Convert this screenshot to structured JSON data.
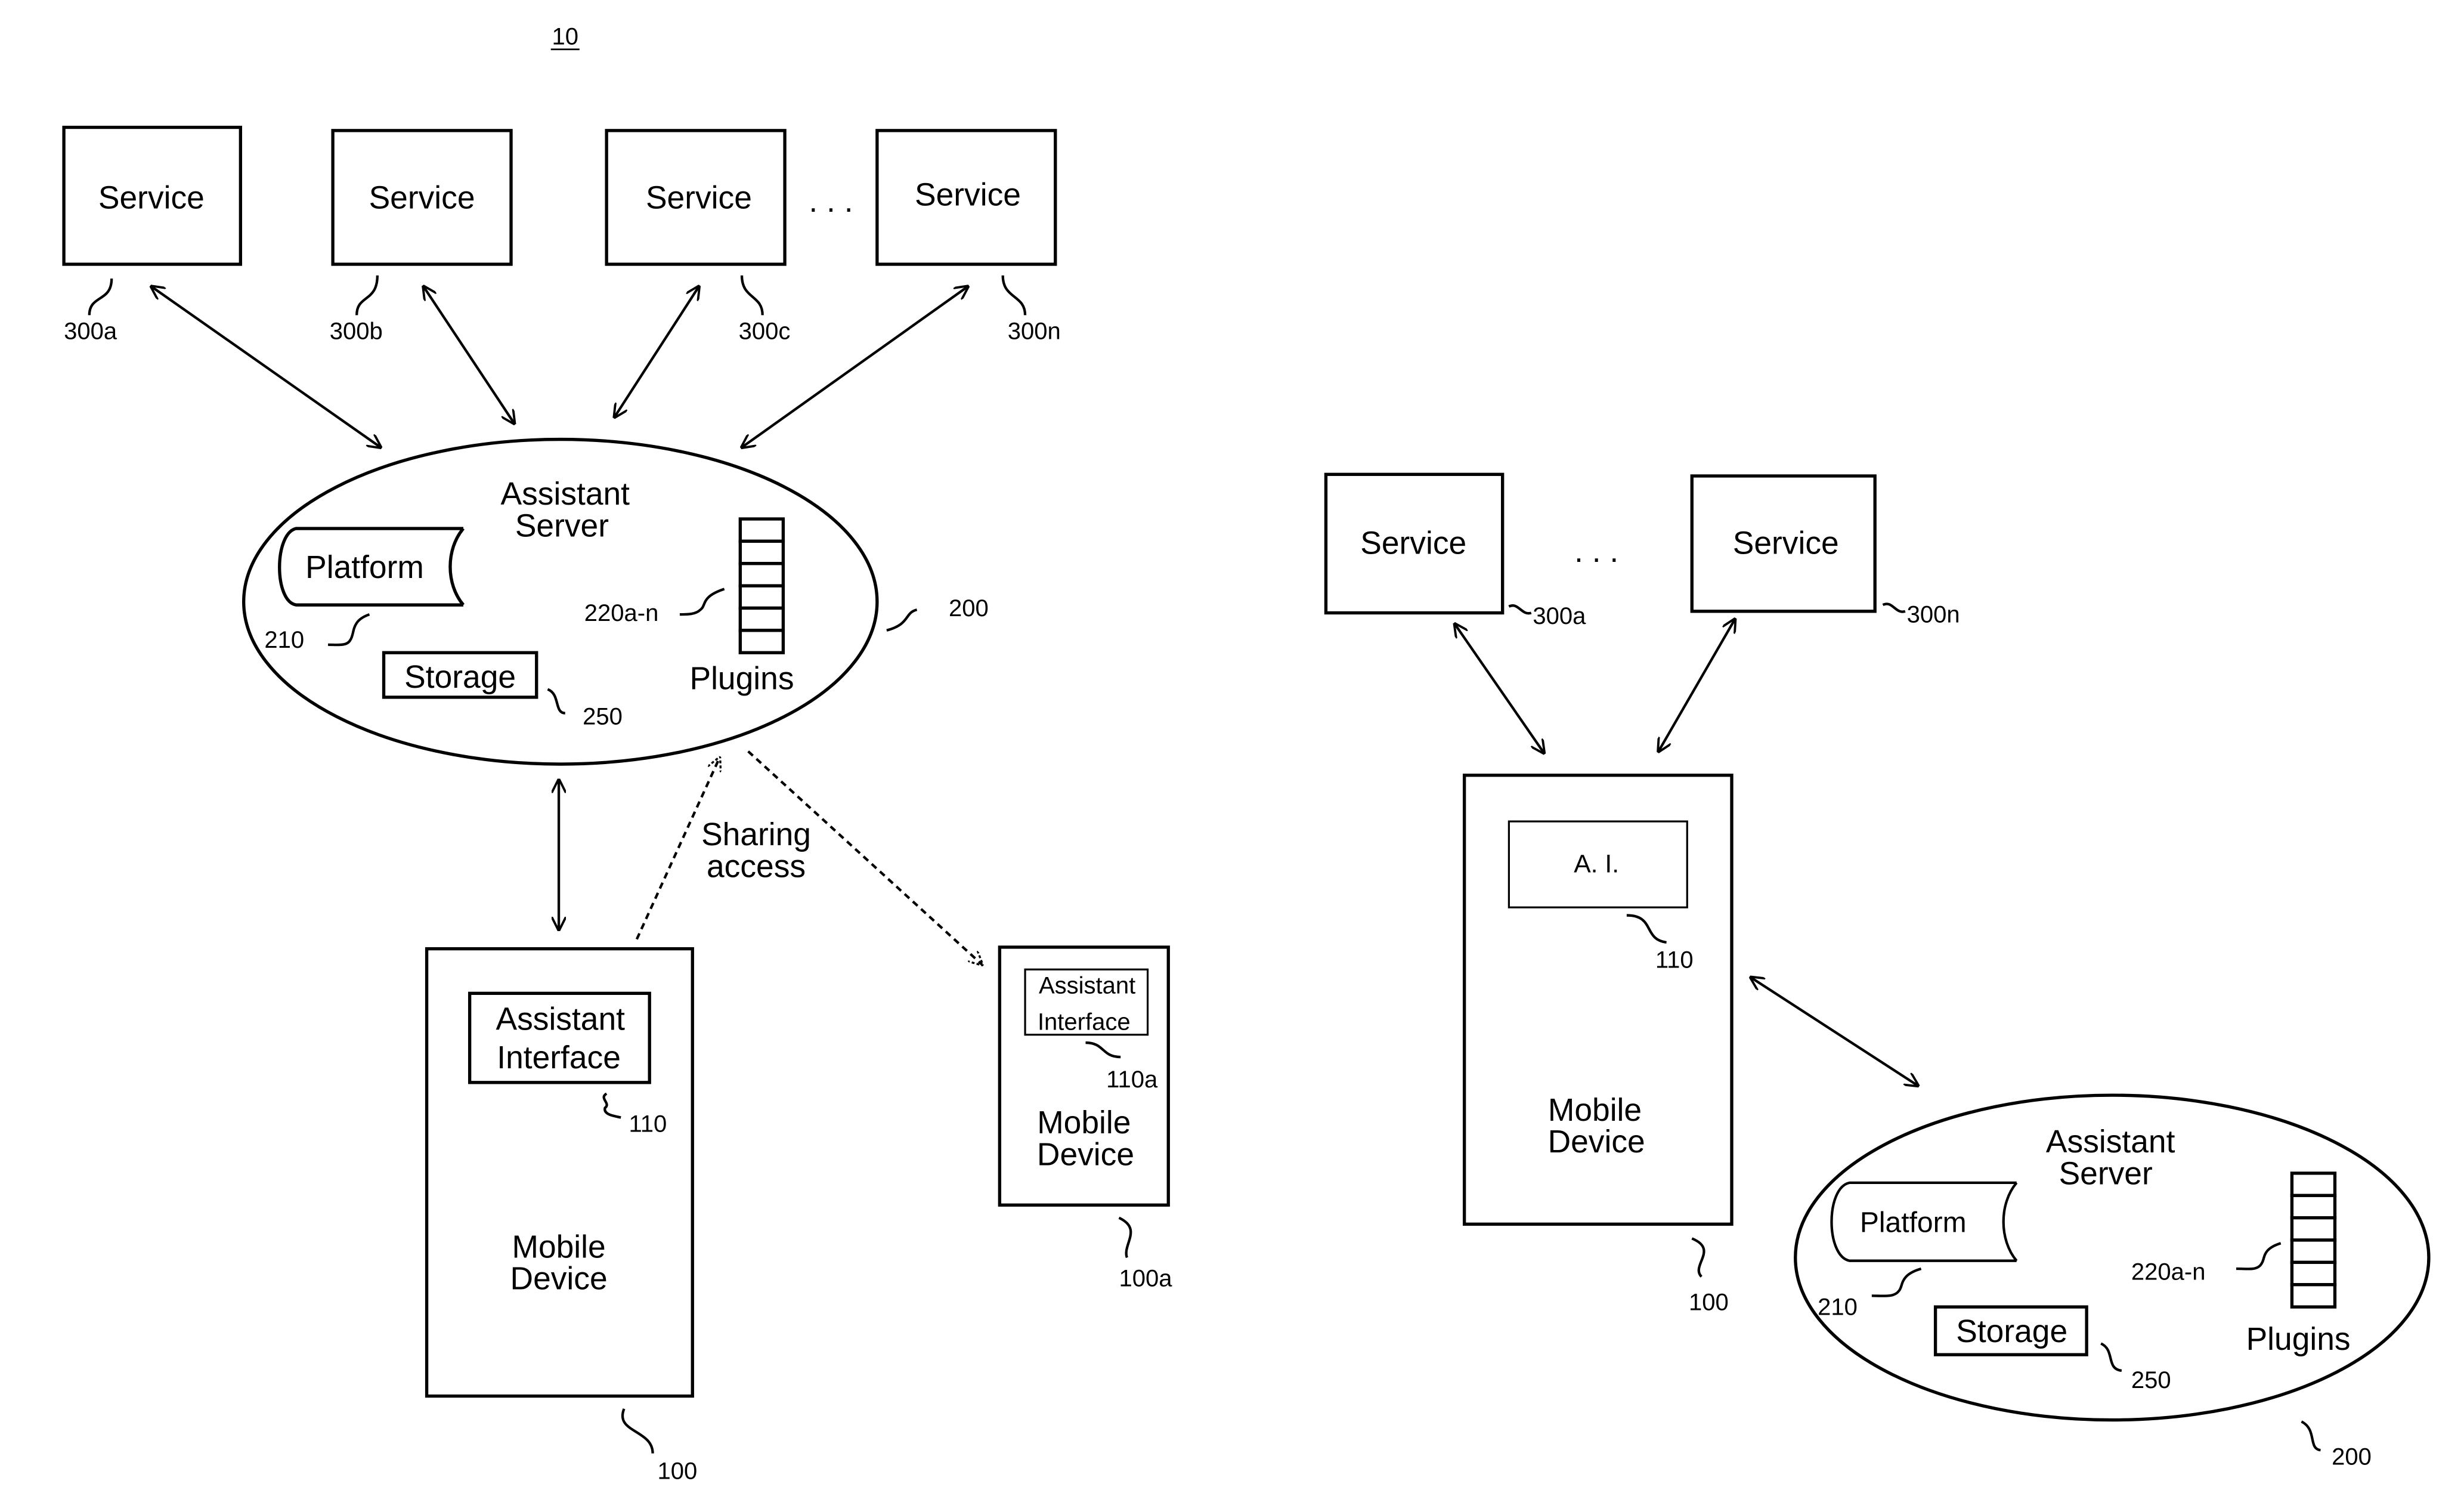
{
  "figure_number": "10",
  "left": {
    "services": [
      {
        "label": "Service",
        "ref": "300a"
      },
      {
        "label": "Service",
        "ref": "300b"
      },
      {
        "label": "Service",
        "ref": "300c"
      },
      {
        "label": "Service",
        "ref": "300n"
      }
    ],
    "ellipsis": ". . .",
    "server": {
      "title_line1": "Assistant",
      "title_line2": "Server",
      "ref": "200",
      "platform": {
        "label": "Platform",
        "ref": "210"
      },
      "storage": {
        "label": "Storage",
        "ref": "250"
      },
      "plugins": {
        "label": "Plugins",
        "ref": "220a-n",
        "cells": 6
      }
    },
    "sharing_label_line1": "Sharing",
    "sharing_label_line2": "access",
    "device": {
      "label_line1": "Mobile",
      "label_line2": "Device",
      "ref": "100",
      "interface_line1": "Assistant",
      "interface_line2": "Interface",
      "interface_ref": "110"
    },
    "device_a": {
      "label_line1": "Mobile",
      "label_line2": "Device",
      "ref": "100a",
      "interface_line1": "Assistant",
      "interface_line2": "Interface",
      "interface_ref": "110a"
    }
  },
  "right": {
    "services": [
      {
        "label": "Service",
        "ref": "300a"
      },
      {
        "label": "Service",
        "ref": "300n"
      }
    ],
    "ellipsis": ". . .",
    "device": {
      "label_line1": "Mobile",
      "label_line2": "Device",
      "ref": "100",
      "ai_label": "A. I.",
      "ai_ref": "110"
    },
    "server": {
      "title_line1": "Assistant",
      "title_line2": "Server",
      "ref": "200",
      "platform": {
        "label": "Platform",
        "ref": "210"
      },
      "storage": {
        "label": "Storage",
        "ref": "250"
      },
      "plugins": {
        "label": "Plugins",
        "ref": "220a-n",
        "cells": 6
      }
    }
  }
}
